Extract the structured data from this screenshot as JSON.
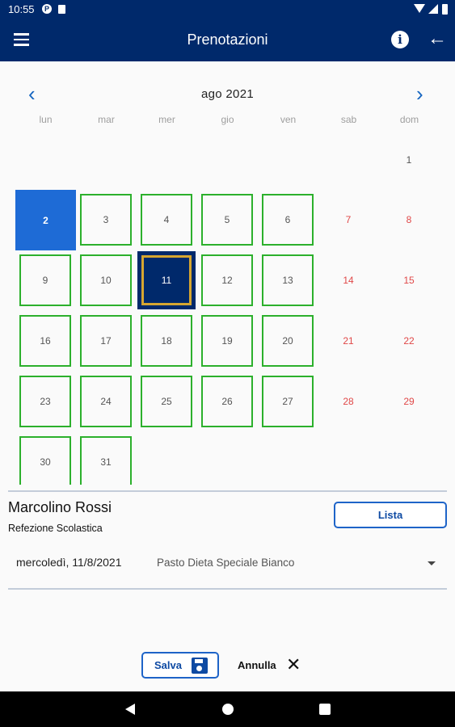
{
  "status_bar": {
    "time": "10:55",
    "p_icon": "P"
  },
  "app_bar": {
    "title": "Prenotazioni",
    "info_icon": "i",
    "back_icon": "←"
  },
  "calendar": {
    "month_label": "ago 2021",
    "prev_icon": "‹",
    "next_icon": "›",
    "weekdays": [
      "lun",
      "mar",
      "mer",
      "gio",
      "ven",
      "sab",
      "dom"
    ],
    "days": [
      "1",
      "2",
      "3",
      "4",
      "5",
      "6",
      "7",
      "8",
      "9",
      "10",
      "11",
      "12",
      "13",
      "14",
      "15",
      "16",
      "17",
      "18",
      "19",
      "20",
      "21",
      "22",
      "23",
      "24",
      "25",
      "26",
      "27",
      "28",
      "29",
      "30",
      "31"
    ],
    "today": "2",
    "selected": "11"
  },
  "booking": {
    "user_name": "Marcolino Rossi",
    "service": "Refezione Scolastica",
    "list_button": "Lista",
    "meal_date": "mercoledì, 11/8/2021",
    "meal_type": "Pasto Dieta Speciale Bianco"
  },
  "actions": {
    "save_label": "Salva",
    "cancel_label": "Annulla",
    "cancel_icon": "✕"
  },
  "colors": {
    "primary": "#00296b",
    "accent": "#1e6bd6",
    "available_border": "#2cb02c",
    "weekend": "#e04848",
    "selected_ring": "#d6a630"
  }
}
